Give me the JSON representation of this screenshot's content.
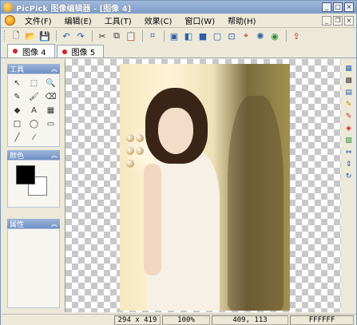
{
  "window": {
    "title": "PicPick 图像编辑器 - [图像 4]"
  },
  "menu": {
    "items": [
      "文件(F)",
      "编辑(E)",
      "工具(T)",
      "效果(C)",
      "窗口(W)",
      "帮助(H)"
    ]
  },
  "toolbar": {
    "buttons": [
      {
        "name": "new-icon",
        "glyph": "🗋",
        "color": "#444"
      },
      {
        "name": "open-icon",
        "glyph": "📂",
        "color": "#c98a00"
      },
      {
        "name": "save-icon",
        "glyph": "💾",
        "color": "#2b4f9c"
      },
      {
        "name": "undo-icon",
        "glyph": "↶",
        "color": "#1d55b8"
      },
      {
        "name": "redo-icon",
        "glyph": "↷",
        "color": "#1d55b8"
      },
      {
        "name": "cut-icon",
        "glyph": "✂",
        "color": "#333"
      },
      {
        "name": "copy-icon",
        "glyph": "⧉",
        "color": "#333"
      },
      {
        "name": "paste-icon",
        "glyph": "📋",
        "color": "#8a6a2a"
      },
      {
        "name": "crop-icon",
        "glyph": "⌗",
        "color": "#1d55b8"
      },
      {
        "name": "screen-capture-icon",
        "glyph": "▣",
        "color": "#2d5fa8"
      },
      {
        "name": "window-capture-icon",
        "glyph": "◧",
        "color": "#2d5fa8"
      },
      {
        "name": "fullscreen-icon",
        "glyph": "■",
        "color": "#2d5fa8"
      },
      {
        "name": "region-capture-icon",
        "glyph": "▢",
        "color": "#2d5fa8"
      },
      {
        "name": "fixed-region-icon",
        "glyph": "⊡",
        "color": "#2d5fa8"
      },
      {
        "name": "crosshair-icon",
        "glyph": "⌖",
        "color": "#d2232a"
      },
      {
        "name": "freehand-icon",
        "glyph": "✺",
        "color": "#2d5fa8"
      },
      {
        "name": "color-picker-icon",
        "glyph": "◉",
        "color": "#2d8a3a"
      },
      {
        "name": "share-icon",
        "glyph": "⇪",
        "color": "#d2232a"
      }
    ]
  },
  "tabs": [
    {
      "label": "图像 4",
      "active": true
    },
    {
      "label": "图像 5",
      "active": false
    }
  ],
  "panels": {
    "tools_title": "工具",
    "colors_title": "颜色",
    "properties_title": "属性",
    "tools": [
      {
        "name": "pointer-tool-icon",
        "glyph": "↖"
      },
      {
        "name": "select-tool-icon",
        "glyph": "⬚"
      },
      {
        "name": "zoom-tool-icon",
        "glyph": "🔍"
      },
      {
        "name": "pencil-tool-icon",
        "glyph": "✎"
      },
      {
        "name": "brush-tool-icon",
        "glyph": "🖌"
      },
      {
        "name": "eraser-tool-icon",
        "glyph": "⌫"
      },
      {
        "name": "fill-tool-icon",
        "glyph": "◆"
      },
      {
        "name": "text-tool-icon",
        "glyph": "A"
      },
      {
        "name": "image-tool-icon",
        "glyph": "▦"
      },
      {
        "name": "rectangle-tool-icon",
        "glyph": "□"
      },
      {
        "name": "ellipse-tool-icon",
        "glyph": "◯"
      },
      {
        "name": "rounded-rect-tool-icon",
        "glyph": "▭"
      },
      {
        "name": "line-tool-icon",
        "glyph": "╱"
      },
      {
        "name": "eyedropper-tool-icon",
        "glyph": "⁄"
      }
    ],
    "foreground_color": "#000000",
    "background_color": "#FFFFFF"
  },
  "right_toolbar": [
    {
      "name": "effect-1-icon",
      "glyph": "▦",
      "color": "#2d5fa8"
    },
    {
      "name": "effect-2-icon",
      "glyph": "▩",
      "color": "#444"
    },
    {
      "name": "effect-3-icon",
      "glyph": "▤",
      "color": "#2d5fa8"
    },
    {
      "name": "brush-effect-icon",
      "glyph": "✎",
      "color": "#c98a00"
    },
    {
      "name": "pen-effect-icon",
      "glyph": "✎",
      "color": "#d2232a"
    },
    {
      "name": "color-balance-icon",
      "glyph": "◈",
      "color": "#d2232a"
    },
    {
      "name": "palette-icon",
      "glyph": "▨",
      "color": "#2d8a3a"
    },
    {
      "name": "flip-horizontal-icon",
      "glyph": "⇔",
      "color": "#1d55b8"
    },
    {
      "name": "flip-vertical-icon",
      "glyph": "⇕",
      "color": "#1d55b8"
    },
    {
      "name": "rotate-icon",
      "glyph": "↻",
      "color": "#1d55b8"
    }
  ],
  "status": {
    "size": "294 x 419",
    "zoom": "100%",
    "cursor": "409, 113",
    "color": "FFFFFF"
  }
}
